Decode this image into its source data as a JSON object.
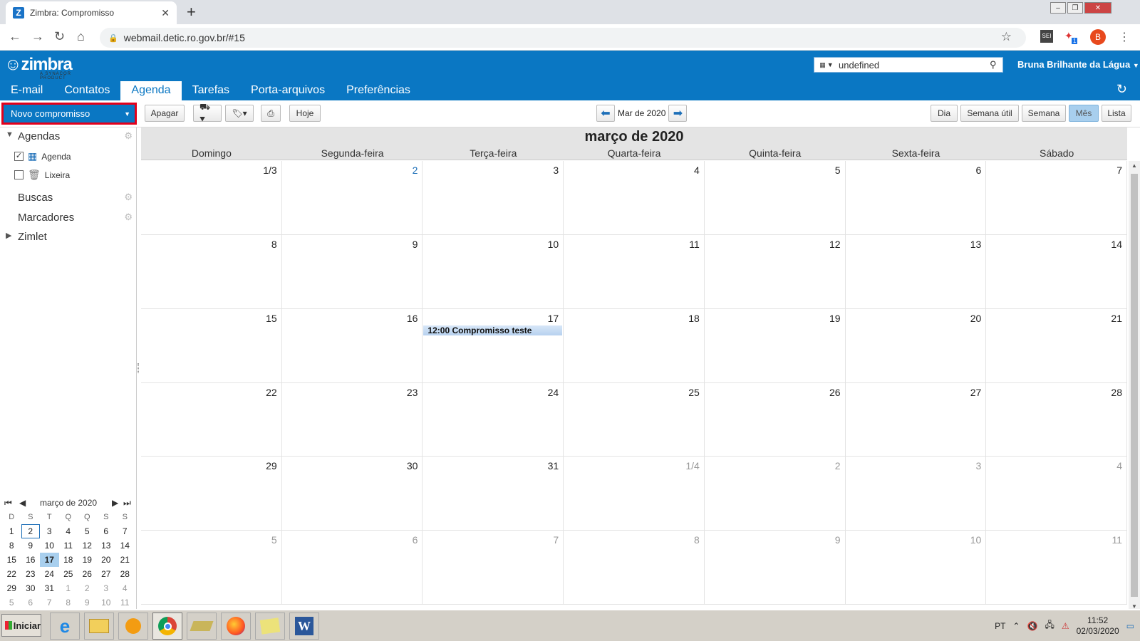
{
  "browser": {
    "tab_title": "Zimbra: Compromisso",
    "tab_icon": "Z",
    "url": "webmail.detic.ro.gov.br/#15",
    "profile_initial": "B",
    "ext_badge": "1"
  },
  "header": {
    "logo": "zimbra",
    "logo_sub": "A SYNACOR PRODUCT",
    "search_value": "undefined",
    "user_name": "Bruna Brilhante da Lágua",
    "app_tabs": [
      "E-mail",
      "Contatos",
      "Agenda",
      "Tarefas",
      "Porta-arquivos",
      "Preferências"
    ],
    "active_tab": "Agenda"
  },
  "toolbar": {
    "new_label": "Novo compromisso",
    "delete_label": "Apagar",
    "today_label": "Hoje",
    "date_label": "Mar de 2020",
    "views": [
      "Dia",
      "Semana útil",
      "Semana",
      "Mês",
      "Lista"
    ],
    "active_view": "Mês"
  },
  "sidebar": {
    "agendas_label": "Agendas",
    "items": [
      {
        "label": "Agenda",
        "checked": true
      },
      {
        "label": "Lixeira",
        "checked": false
      }
    ],
    "buscas_label": "Buscas",
    "marcadores_label": "Marcadores",
    "zimlet_label": "Zimlet"
  },
  "minical": {
    "title": "março de 2020",
    "weekdays": [
      "D",
      "S",
      "T",
      "Q",
      "Q",
      "S",
      "S"
    ],
    "weeks": [
      [
        "1",
        "2",
        "3",
        "4",
        "5",
        "6",
        "7"
      ],
      [
        "8",
        "9",
        "10",
        "11",
        "12",
        "13",
        "14"
      ],
      [
        "15",
        "16",
        "17",
        "18",
        "19",
        "20",
        "21"
      ],
      [
        "22",
        "23",
        "24",
        "25",
        "26",
        "27",
        "28"
      ],
      [
        "29",
        "30",
        "31",
        "1",
        "2",
        "3",
        "4"
      ],
      [
        "5",
        "6",
        "7",
        "8",
        "9",
        "10",
        "11"
      ]
    ],
    "today": "17",
    "selected": "2"
  },
  "calendar": {
    "title": "março de 2020",
    "weekdays": [
      "Domingo",
      "Segunda-feira",
      "Terça-feira",
      "Quarta-feira",
      "Quinta-feira",
      "Sexta-feira",
      "Sábado"
    ],
    "weeks": [
      [
        "1/3",
        "2",
        "3",
        "4",
        "5",
        "6",
        "7"
      ],
      [
        "8",
        "9",
        "10",
        "11",
        "12",
        "13",
        "14"
      ],
      [
        "15",
        "16",
        "17",
        "18",
        "19",
        "20",
        "21"
      ],
      [
        "22",
        "23",
        "24",
        "25",
        "26",
        "27",
        "28"
      ],
      [
        "29",
        "30",
        "31",
        "1/4",
        "2",
        "3",
        "4"
      ],
      [
        "5",
        "6",
        "7",
        "8",
        "9",
        "10",
        "11"
      ]
    ],
    "selected_day": "2",
    "event": {
      "day": "17",
      "text": "12:00 Compromisso teste"
    }
  },
  "taskbar": {
    "start_label": "Iniciar",
    "lang": "PT",
    "time": "11:52",
    "date": "02/03/2020"
  },
  "colors": {
    "brand": "#0a77c3",
    "highlight": "#e3001b"
  }
}
